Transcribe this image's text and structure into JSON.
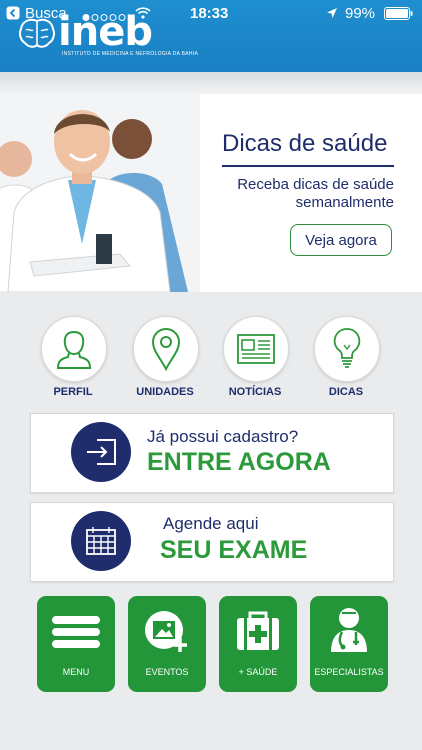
{
  "status_bar": {
    "back_label": "Busca",
    "time": "18:33",
    "battery": "99%"
  },
  "header": {
    "logo_text": "ineb",
    "logo_subtitle": "INSTITUTO DE MEDICINA E NEFROLOGIA DA BAHIA"
  },
  "banner": {
    "title": "Dicas de saúde",
    "subtitle": "Receba dicas de saúde semanalmente",
    "cta_label": "Veja agora"
  },
  "quick_nav": [
    {
      "label": "PERFIL",
      "icon": "person-icon"
    },
    {
      "label": "UNIDADES",
      "icon": "map-pin-icon"
    },
    {
      "label": "NOTÍCIAS",
      "icon": "newspaper-icon"
    },
    {
      "label": "DICAS",
      "icon": "lightbulb-icon"
    }
  ],
  "login_card": {
    "question": "Já possui cadastro?",
    "action": "ENTRE AGORA",
    "icon": "login-icon"
  },
  "exam_card": {
    "question": "Agende aqui",
    "action": "SEU EXAME",
    "icon": "calendar-icon"
  },
  "bottom_tiles": [
    {
      "label": "MENU",
      "icon": "menu-icon"
    },
    {
      "label": "EVENTOS",
      "icon": "add-photo-icon"
    },
    {
      "label": "+ SAÚDE",
      "icon": "medical-kit-icon"
    },
    {
      "label": "ESPECIALISTAS",
      "icon": "doctor-icon"
    }
  ],
  "colors": {
    "header_blue": "#1e8fd0",
    "navy": "#1f2d6c",
    "green": "#24963a"
  }
}
